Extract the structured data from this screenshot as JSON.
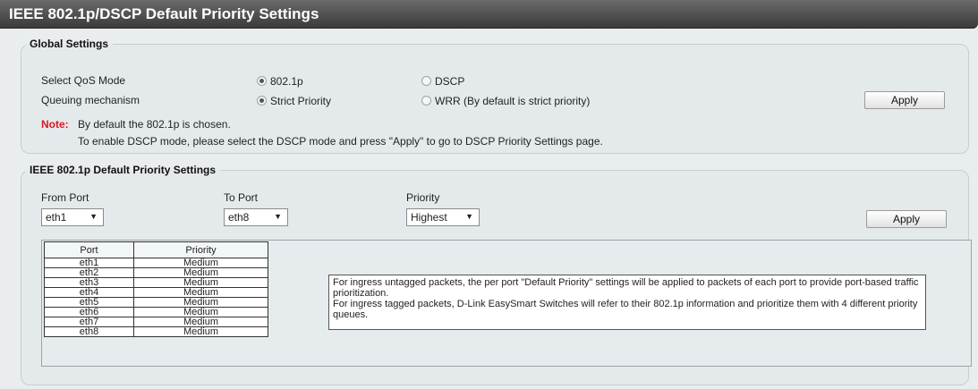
{
  "header": {
    "title": "IEEE 802.1p/DSCP Default Priority Settings"
  },
  "global": {
    "legend": "Global Settings",
    "qos_label": "Select QoS Mode",
    "qos_options": [
      "802.1p",
      "DSCP"
    ],
    "qos_selected": "802.1p",
    "queue_label": "Queuing mechanism",
    "queue_options": [
      "Strict Priority",
      "WRR (By default is strict priority)"
    ],
    "queue_selected": "Strict Priority",
    "apply_label": "Apply",
    "note_label": "Note:",
    "note_line1": "By default the 802.1p is chosen.",
    "note_line2": "To enable DSCP mode, please select the DSCP mode and press \"Apply\" to go to DSCP Priority Settings page."
  },
  "default_priority": {
    "legend": "IEEE 802.1p Default Priority Settings",
    "from_port_label": "From Port",
    "from_port_value": "eth1",
    "to_port_label": "To Port",
    "to_port_value": "eth8",
    "priority_label": "Priority",
    "priority_value": "Highest",
    "apply_label": "Apply",
    "table": {
      "headers": [
        "Port",
        "Priority"
      ],
      "rows": [
        [
          "eth1",
          "Medium"
        ],
        [
          "eth2",
          "Medium"
        ],
        [
          "eth3",
          "Medium"
        ],
        [
          "eth4",
          "Medium"
        ],
        [
          "eth5",
          "Medium"
        ],
        [
          "eth6",
          "Medium"
        ],
        [
          "eth7",
          "Medium"
        ],
        [
          "eth8",
          "Medium"
        ]
      ]
    },
    "info_line1": "For ingress untagged packets, the per port \"Default Priority\" settings will be applied to packets of each port to provide port-based traffic prioritization.",
    "info_line2": "For ingress tagged packets, D-Link EasySmart Switches will refer to their 802.1p information and prioritize them with 4 different priority queues."
  }
}
